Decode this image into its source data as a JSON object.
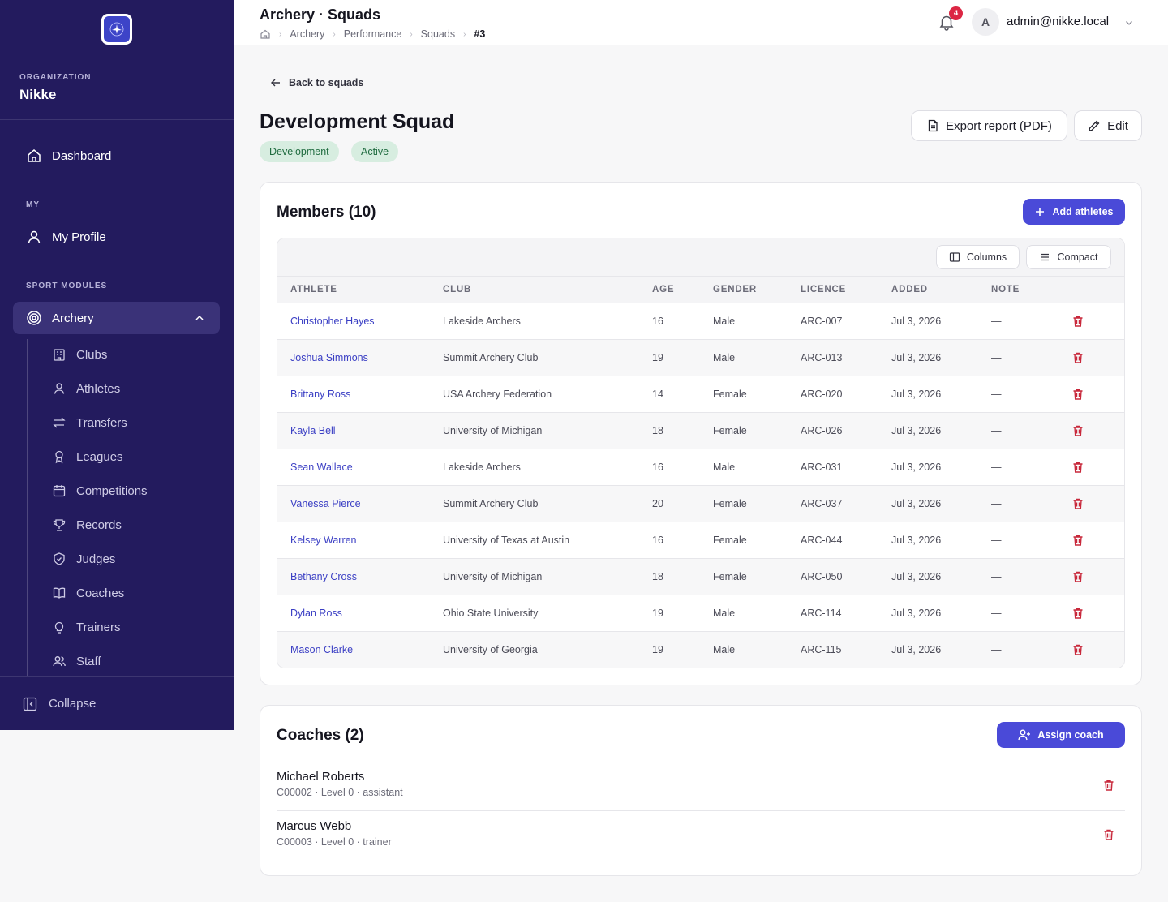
{
  "app": {
    "logo_name": "nikke-logo",
    "org_label": "ORGANIZATION",
    "org_name": "Nikke"
  },
  "sidebar": {
    "dashboard": "Dashboard",
    "section_my": "MY",
    "my_profile": "My Profile",
    "section_sport": "SPORT MODULES",
    "archery": "Archery",
    "sub_items": [
      {
        "label": "Clubs",
        "icon": "building-icon"
      },
      {
        "label": "Athletes",
        "icon": "user-icon"
      },
      {
        "label": "Transfers",
        "icon": "transfer-icon"
      },
      {
        "label": "Leagues",
        "icon": "award-icon"
      },
      {
        "label": "Competitions",
        "icon": "calendar-icon"
      },
      {
        "label": "Records",
        "icon": "trophy-icon"
      },
      {
        "label": "Judges",
        "icon": "shield-icon"
      },
      {
        "label": "Coaches",
        "icon": "book-icon"
      },
      {
        "label": "Trainers",
        "icon": "lightbulb-icon"
      },
      {
        "label": "Staff",
        "icon": "users-icon"
      }
    ],
    "collapse": "Collapse"
  },
  "header": {
    "title": "Archery · Squads",
    "breadcrumb": [
      "Archery",
      "Performance",
      "Squads",
      "#3"
    ],
    "notification_count": "4",
    "avatar_initial": "A",
    "user_email": "admin@nikke.local"
  },
  "page": {
    "back_label": "Back to squads",
    "title": "Development Squad",
    "badges": [
      "Development",
      "Active"
    ],
    "export_label": "Export report (PDF)",
    "edit_label": "Edit"
  },
  "members": {
    "title": "Members (10)",
    "add_label": "Add athletes",
    "columns_label": "Columns",
    "compact_label": "Compact",
    "headers": [
      "ATHLETE",
      "CLUB",
      "AGE",
      "GENDER",
      "LICENCE",
      "ADDED",
      "NOTE"
    ],
    "rows": [
      {
        "athlete": "Christopher Hayes",
        "club": "Lakeside Archers",
        "age": "16",
        "gender": "Male",
        "licence": "ARC-007",
        "added": "Jul 3, 2026",
        "note": "—"
      },
      {
        "athlete": "Joshua Simmons",
        "club": "Summit Archery Club",
        "age": "19",
        "gender": "Male",
        "licence": "ARC-013",
        "added": "Jul 3, 2026",
        "note": "—"
      },
      {
        "athlete": "Brittany Ross",
        "club": "USA Archery Federation",
        "age": "14",
        "gender": "Female",
        "licence": "ARC-020",
        "added": "Jul 3, 2026",
        "note": "—"
      },
      {
        "athlete": "Kayla Bell",
        "club": "University of Michigan",
        "age": "18",
        "gender": "Female",
        "licence": "ARC-026",
        "added": "Jul 3, 2026",
        "note": "—"
      },
      {
        "athlete": "Sean Wallace",
        "club": "Lakeside Archers",
        "age": "16",
        "gender": "Male",
        "licence": "ARC-031",
        "added": "Jul 3, 2026",
        "note": "—"
      },
      {
        "athlete": "Vanessa Pierce",
        "club": "Summit Archery Club",
        "age": "20",
        "gender": "Female",
        "licence": "ARC-037",
        "added": "Jul 3, 2026",
        "note": "—"
      },
      {
        "athlete": "Kelsey Warren",
        "club": "University of Texas at Austin",
        "age": "16",
        "gender": "Female",
        "licence": "ARC-044",
        "added": "Jul 3, 2026",
        "note": "—"
      },
      {
        "athlete": "Bethany Cross",
        "club": "University of Michigan",
        "age": "18",
        "gender": "Female",
        "licence": "ARC-050",
        "added": "Jul 3, 2026",
        "note": "—"
      },
      {
        "athlete": "Dylan Ross",
        "club": "Ohio State University",
        "age": "19",
        "gender": "Male",
        "licence": "ARC-114",
        "added": "Jul 3, 2026",
        "note": "—"
      },
      {
        "athlete": "Mason Clarke",
        "club": "University of Georgia",
        "age": "19",
        "gender": "Male",
        "licence": "ARC-115",
        "added": "Jul 3, 2026",
        "note": "—"
      }
    ]
  },
  "coaches": {
    "title": "Coaches (2)",
    "assign_label": "Assign coach",
    "items": [
      {
        "name": "Michael Roberts",
        "meta": "C00002 · Level 0 · assistant"
      },
      {
        "name": "Marcus Webb",
        "meta": "C00003 · Level 0 · trainer"
      }
    ]
  },
  "colors": {
    "sidebar_bg": "#231b5e",
    "primary": "#4a4ad8",
    "link": "#3b3fc4",
    "danger": "#c8283b",
    "badge_bg": "#d7ede0",
    "badge_text": "#1f6b3f"
  }
}
